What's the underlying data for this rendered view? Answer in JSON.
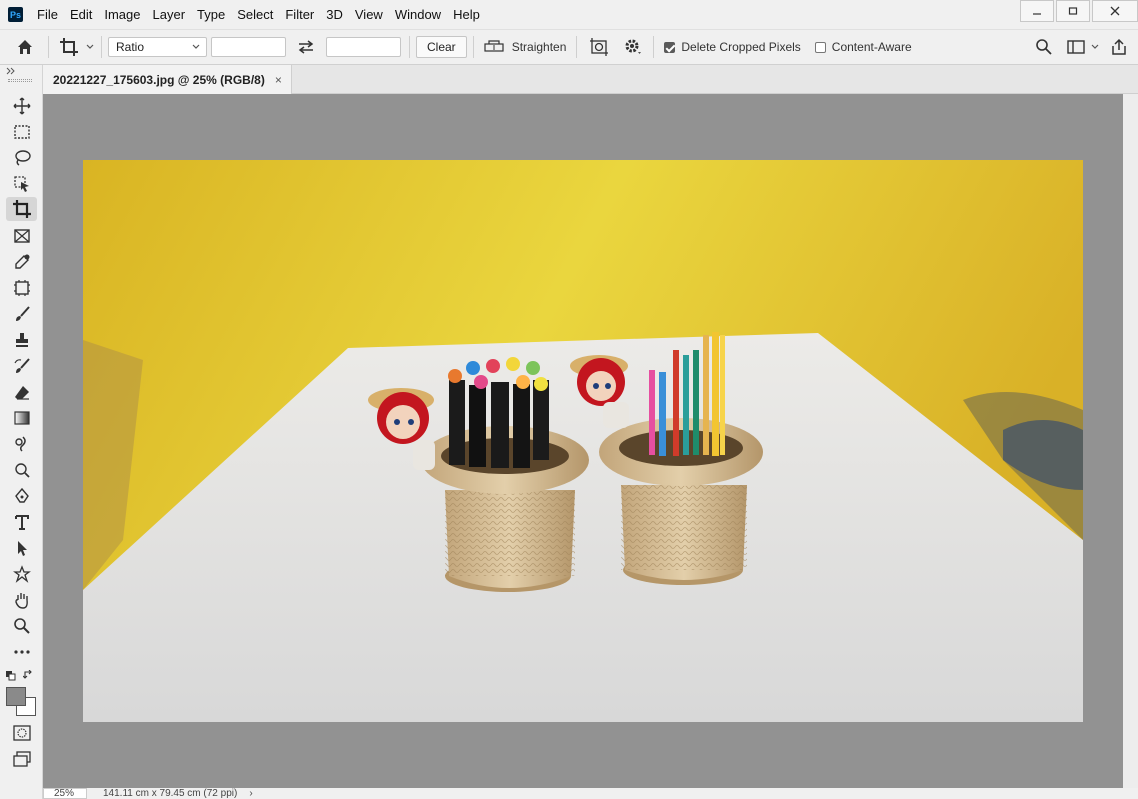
{
  "app": {
    "logo_text": "Ps"
  },
  "menu": [
    "File",
    "Edit",
    "Image",
    "Layer",
    "Type",
    "Select",
    "Filter",
    "3D",
    "View",
    "Window",
    "Help"
  ],
  "options": {
    "ratio_value": "Ratio",
    "width_value": "",
    "height_value": "",
    "clear_label": "Clear",
    "straighten_label": "Straighten",
    "delete_cropped_label": "Delete Cropped Pixels",
    "delete_cropped_checked": true,
    "content_aware_label": "Content-Aware",
    "content_aware_checked": false
  },
  "document": {
    "tab_title": "20221227_175603.jpg @ 25% (RGB/8)",
    "close_glyph": "×"
  },
  "status": {
    "zoom": "25%",
    "doc_size": "141.11 cm x 79.45 cm (72 ppi)",
    "arrow": "›"
  },
  "colors": {
    "accent": "#31a8ff",
    "canvas_bg": "#929292",
    "foreground_swatch": "#8a8a8a",
    "background_swatch": "#ffffff"
  }
}
